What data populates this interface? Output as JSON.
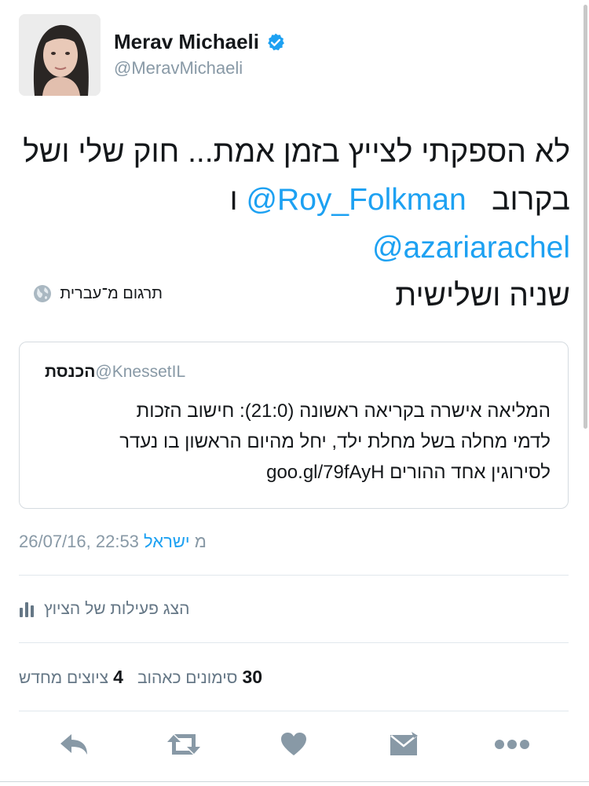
{
  "author": {
    "name": "Merav Michaeli",
    "handle": "@MeravMichaeli"
  },
  "tweet": {
    "line1": "לא הספקתי לצייץ בזמן אמת... חוק שלי ושל",
    "line2_before": "בקרוב",
    "mention1": "@Roy_Folkman",
    "connector": "ו",
    "mention2": "@azariarachel",
    "line3": "שניה ושלישית"
  },
  "translate_label": "תרגום מ־עברית",
  "quoted_tweet": {
    "name": "הכנסת",
    "handle": "@KnessetIL",
    "text_line1": "המליאה אישרה בקריאה ראשונה (21:0): חישוב הזכות",
    "text_line2": "לדמי מחלה בשל מחלת ילד, יחל מהיום הראשון בו נעדר",
    "text_line3": "לסירוגין אחד ההורים goo.gl/79fAyH"
  },
  "meta": {
    "timestamp": "26/07/16, 22:53",
    "from_word": "מ",
    "source": "ישראל"
  },
  "activity_label": "הצג פעילות של הציוץ",
  "stats": {
    "likes_count": "30",
    "likes_label": "סימונים כאהוב",
    "retweets_count": "4",
    "retweets_label": "ציוצים מחדש"
  },
  "icons": {
    "verified": "verified-badge-icon",
    "globe": "globe-icon",
    "activity": "bar-chart-icon",
    "reply": "reply-icon",
    "retweet": "retweet-icon",
    "like": "heart-icon",
    "message": "envelope-icon",
    "more": "more-dots-icon"
  },
  "colors": {
    "accent": "#1da1f2",
    "muted": "#8899a6",
    "icon": "#8899a6"
  }
}
